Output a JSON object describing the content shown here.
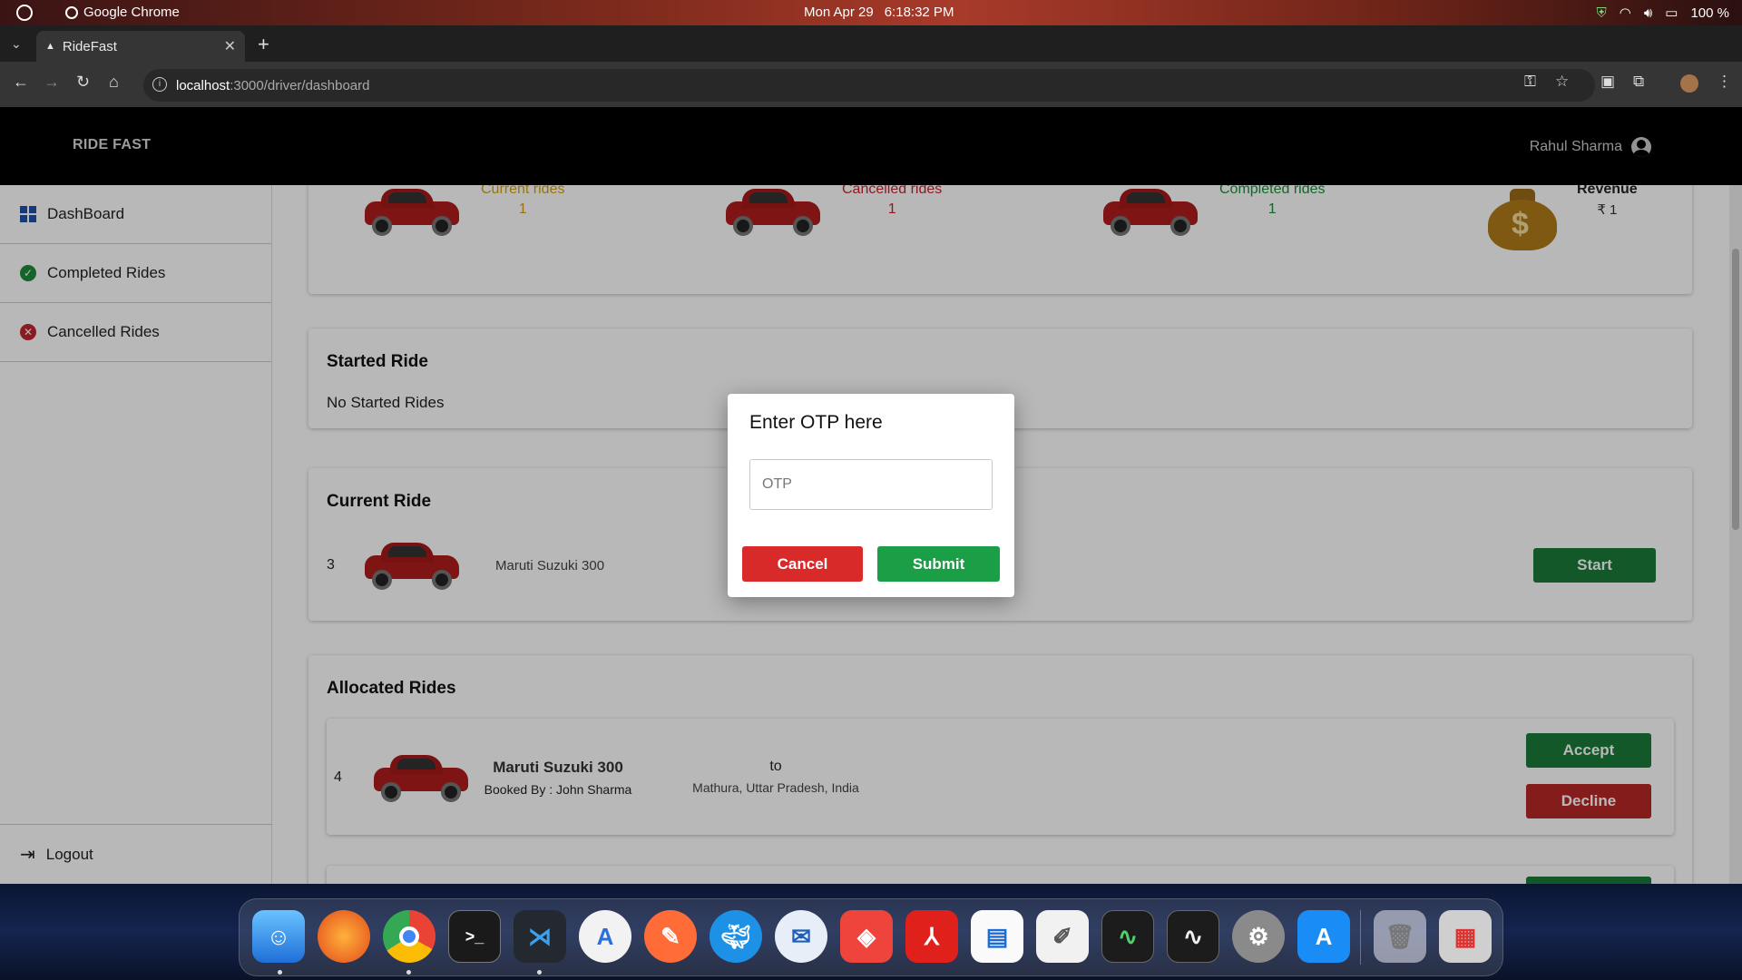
{
  "menubar": {
    "app_name": "Google Chrome",
    "date": "Mon Apr 29",
    "time": "6:18:32 PM",
    "battery": "100 %"
  },
  "browser": {
    "tab_title": "RideFast",
    "url_host": "localhost",
    "url_path": ":3000/driver/dashboard"
  },
  "app": {
    "brand": "RIDE FAST",
    "user_name": "Rahul Sharma"
  },
  "sidebar": {
    "items": [
      {
        "label": "DashBoard"
      },
      {
        "label": "Completed Rides"
      },
      {
        "label": "Cancelled Rides"
      }
    ],
    "logout_label": "Logout"
  },
  "stats": {
    "current": {
      "label": "Current rides",
      "value": "1",
      "color": "#d4a017"
    },
    "cancelled": {
      "label": "Cancelled rides",
      "value": "1",
      "color": "#c0262f"
    },
    "completed": {
      "label": "Completed rides",
      "value": "1",
      "color": "#1e8b3a"
    },
    "revenue": {
      "label": "Revenue",
      "value": "₹ 1"
    }
  },
  "started_ride": {
    "title": "Started Ride",
    "empty_text": "No Started Rides"
  },
  "current_ride": {
    "title": "Current Ride",
    "id": "3",
    "car": "Maruti Suzuki 300",
    "start_label": "Start"
  },
  "allocated_rides": {
    "title": "Allocated Rides",
    "rides": [
      {
        "id": "4",
        "car": "Maruti Suzuki 300",
        "booked_by": "Booked By : John Sharma",
        "to_label": "to",
        "destination": "Mathura, Uttar Pradesh, India",
        "accept_label": "Accept",
        "decline_label": "Decline"
      }
    ]
  },
  "modal": {
    "title": "Enter OTP here",
    "placeholder": "OTP",
    "cancel_label": "Cancel",
    "submit_label": "Submit"
  },
  "colors": {
    "accent_green": "#1a9e46",
    "accent_red": "#d92a2a"
  },
  "dock": {
    "apps": [
      "finder-icon",
      "firefox-icon",
      "chrome-icon",
      "terminal-icon",
      "vscode-icon",
      "android-studio-icon",
      "postman-icon",
      "docker-icon",
      "thunderbird-icon",
      "anydesk-icon",
      "acrobat-icon",
      "pages-icon",
      "textedit-icon",
      "activity-monitor-icon",
      "console-icon",
      "system-preferences-icon",
      "app-store-icon",
      "trash-icon",
      "launchpad-icon"
    ]
  }
}
